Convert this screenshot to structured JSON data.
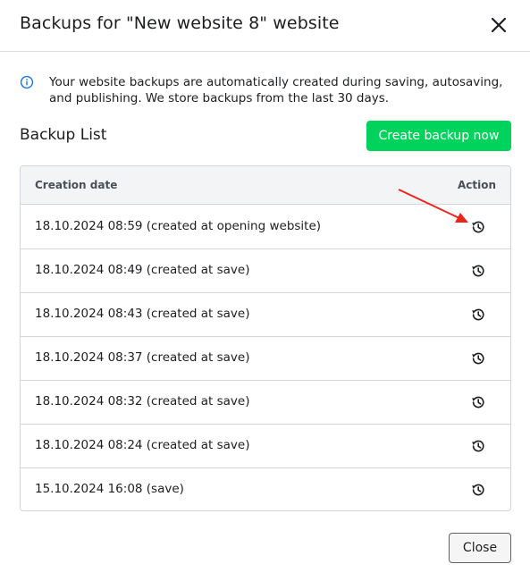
{
  "dialog": {
    "title": "Backups for \"New website 8\" website",
    "info_text": "Your website backups are automatically created during saving, autosaving, and publishing. We store backups from the last 30 days.",
    "section_title": "Backup List",
    "create_button": "Create backup now",
    "close_button": "Close"
  },
  "table": {
    "headers": {
      "date": "Creation date",
      "action": "Action"
    },
    "rows": [
      {
        "date": "18.10.2024 08:59 (created at opening website)"
      },
      {
        "date": "18.10.2024 08:49 (created at save)"
      },
      {
        "date": "18.10.2024 08:43 (created at save)"
      },
      {
        "date": "18.10.2024 08:37 (created at save)"
      },
      {
        "date": "18.10.2024 08:32 (created at save)"
      },
      {
        "date": "18.10.2024 08:24 (created at save)"
      },
      {
        "date": "15.10.2024 16:08 (save)"
      }
    ]
  },
  "colors": {
    "accent_green": "#00d35c",
    "info_blue": "#1a73e8",
    "annotation_red": "#e8261d"
  },
  "icons": [
    "close-icon",
    "info-icon",
    "restore-icon"
  ]
}
